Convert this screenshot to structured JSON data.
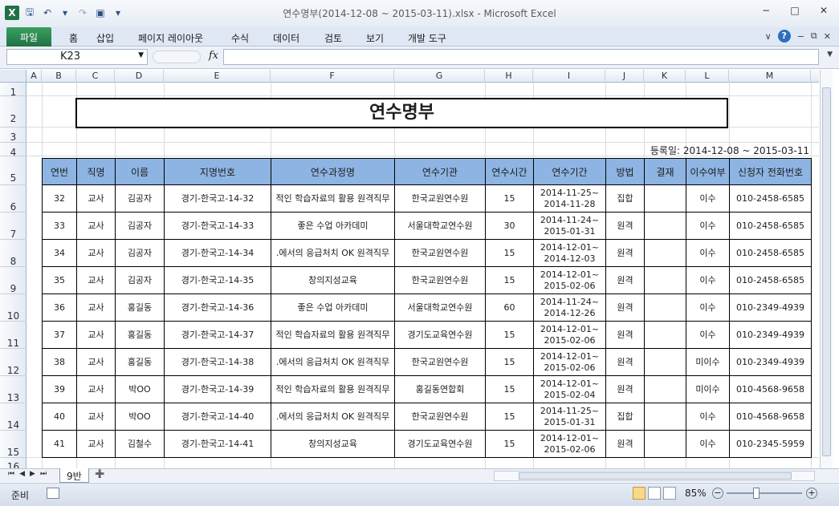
{
  "window": {
    "title": "연수명부(2014-12-08 ~ 2015-03-11).xlsx  -  Microsoft Excel"
  },
  "ribbon": {
    "tabs": [
      "파일",
      "홈",
      "삽입",
      "페이지 레이아웃",
      "수식",
      "데이터",
      "검토",
      "보기",
      "개발 도구"
    ]
  },
  "formula_bar": {
    "name_box": "K23",
    "fx_label": "fx",
    "content": ""
  },
  "columns": [
    "A",
    "B",
    "C",
    "D",
    "E",
    "F",
    "G",
    "H",
    "I",
    "J",
    "K",
    "L",
    "M"
  ],
  "rows": [
    "1",
    "2",
    "3",
    "4",
    "5",
    "6",
    "7",
    "8",
    "9",
    "10",
    "11",
    "12",
    "13",
    "14",
    "15",
    "16"
  ],
  "sheet": {
    "title": "연수명부",
    "registration": "등록일: 2014-12-08 ~ 2015-03-11",
    "headers": [
      "연번",
      "직명",
      "이름",
      "지명번호",
      "연수과정명",
      "연수기관",
      "연수시간",
      "연수기간",
      "방법",
      "결재",
      "이수여부",
      "신청자 전화번호"
    ],
    "records": [
      [
        "32",
        "교사",
        "김공자",
        "경기-한국고-14-32",
        "적인 학습자료의 활용 원격직무",
        "한국교원연수원",
        "15",
        "2014-11-25~\n2014-11-28",
        "집합",
        "",
        "이수",
        "010-2458-6585"
      ],
      [
        "33",
        "교사",
        "김공자",
        "경기-한국고-14-33",
        "좋은 수업 아카데미",
        "서울대학교연수원",
        "30",
        "2014-11-24~\n2015-01-31",
        "원격",
        "",
        "이수",
        "010-2458-6585"
      ],
      [
        "34",
        "교사",
        "김공자",
        "경기-한국고-14-34",
        ".에서의 응급처치 OK 원격직무",
        "한국교원연수원",
        "15",
        "2014-12-01~\n2014-12-03",
        "원격",
        "",
        "이수",
        "010-2458-6585"
      ],
      [
        "35",
        "교사",
        "김공자",
        "경기-한국고-14-35",
        "창의지성교육",
        "한국교원연수원",
        "15",
        "2014-12-01~\n2015-02-06",
        "원격",
        "",
        "이수",
        "010-2458-6585"
      ],
      [
        "36",
        "교사",
        "홍길동",
        "경기-한국고-14-36",
        "좋은 수업 아카데미",
        "서울대학교연수원",
        "60",
        "2014-11-24~\n2014-12-26",
        "원격",
        "",
        "이수",
        "010-2349-4939"
      ],
      [
        "37",
        "교사",
        "홍길동",
        "경기-한국고-14-37",
        "적인 학습자료의 활용 원격직무",
        "경기도교육연수원",
        "15",
        "2014-12-01~\n2015-02-06",
        "원격",
        "",
        "이수",
        "010-2349-4939"
      ],
      [
        "38",
        "교사",
        "홍길동",
        "경기-한국고-14-38",
        ".에서의 응급처치 OK 원격직무",
        "한국교원연수원",
        "15",
        "2014-12-01~\n2015-02-06",
        "원격",
        "",
        "미이수",
        "010-2349-4939"
      ],
      [
        "39",
        "교사",
        "박OO",
        "경기-한국고-14-39",
        "적인 학습자료의 활용 원격직무",
        "홍길동연합회",
        "15",
        "2014-12-01~\n2015-02-04",
        "원격",
        "",
        "미이수",
        "010-4568-9658"
      ],
      [
        "40",
        "교사",
        "박OO",
        "경기-한국고-14-40",
        ".에서의 응급처치 OK 원격직무",
        "한국교원연수원",
        "15",
        "2014-11-25~\n2015-01-31",
        "집합",
        "",
        "이수",
        "010-4568-9658"
      ],
      [
        "41",
        "교사",
        "김철수",
        "경기-한국고-14-41",
        "창의지성교육",
        "경기도교육연수원",
        "15",
        "2014-12-01~\n2015-02-06",
        "원격",
        "",
        "이수",
        "010-2345-5959"
      ]
    ]
  },
  "sheet_tabs": [
    "9반"
  ],
  "status": {
    "ready": "준비",
    "zoom": "85%"
  },
  "colors": {
    "header_fill": "#8db4e2",
    "excel_green": "#1f7244"
  }
}
